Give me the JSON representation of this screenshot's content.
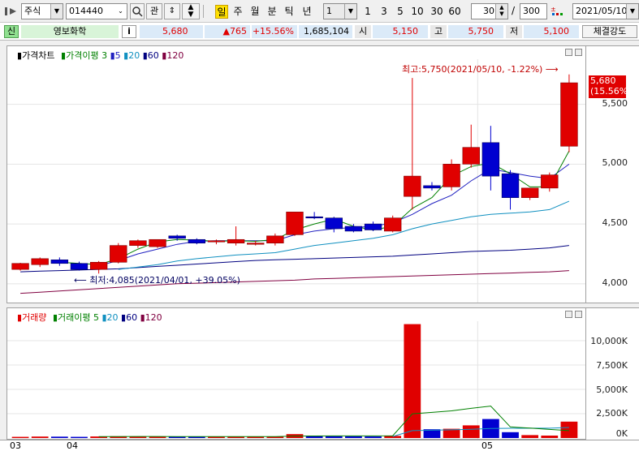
{
  "toolbar": {
    "market_select": "주식",
    "code_input": "014440",
    "search_label": "관",
    "periods": [
      "일",
      "주",
      "월",
      "분",
      "틱",
      "년"
    ],
    "selected_period": "일",
    "interval_value": "1",
    "interval_buttons": [
      "1",
      "3",
      "5",
      "10",
      "30",
      "60"
    ],
    "display_count": "30",
    "total_count": "300",
    "date_value": "2021/05/10"
  },
  "quote": {
    "credit_tag": "신",
    "name": "영보화학",
    "info_label": "i",
    "price": "5,680",
    "change": "▲765",
    "change_pct": "+15.56%",
    "volume": "1,685,104",
    "open_label": "시",
    "open": "5,150",
    "high_label": "고",
    "high": "5,750",
    "low_label": "저",
    "low": "5,100",
    "strength_label": "체결강도"
  },
  "price_panel": {
    "legend_title": "가격차트",
    "ma_title": "가격이평",
    "ma_periods": [
      "3",
      "5",
      "20",
      "60",
      "120"
    ],
    "high_annotation": "최고:5,750(2021/05/10, -1.22%)",
    "low_annotation": "최저:4,085(2021/04/01, +39.05%)",
    "current_price": "5,680",
    "current_pct": "(15.56%)",
    "y_labels": [
      "5,500",
      "5,000",
      "4,500",
      "4,000"
    ]
  },
  "volume_panel": {
    "legend_title": "거래량",
    "ma_title": "거래이평",
    "ma_periods": [
      "5",
      "20",
      "60",
      "120"
    ],
    "y_labels": [
      "10,000K",
      "7,500K",
      "5,000K",
      "2,500K",
      "0K"
    ]
  },
  "x_labels": [
    "03",
    "04",
    "05"
  ],
  "colors": {
    "up": "#e00000",
    "down": "#0000d0",
    "ma3": "#008000",
    "ma5": "#2020c0",
    "ma20": "#1090c0",
    "ma60": "#000080",
    "ma120": "#800040"
  },
  "chart_data": {
    "type": "candlestick",
    "price_range": [
      3870,
      5850
    ],
    "candles": [
      {
        "o": 4120,
        "h": 4175,
        "l": 4110,
        "c": 4170
      },
      {
        "o": 4160,
        "h": 4220,
        "l": 4140,
        "c": 4210
      },
      {
        "o": 4200,
        "h": 4220,
        "l": 4150,
        "c": 4170
      },
      {
        "o": 4170,
        "h": 4185,
        "l": 4110,
        "c": 4120
      },
      {
        "o": 4120,
        "h": 4190,
        "l": 4085,
        "c": 4180
      },
      {
        "o": 4180,
        "h": 4340,
        "l": 4170,
        "c": 4320
      },
      {
        "o": 4320,
        "h": 4370,
        "l": 4300,
        "c": 4360
      },
      {
        "o": 4310,
        "h": 4370,
        "l": 4300,
        "c": 4370
      },
      {
        "o": 4400,
        "h": 4410,
        "l": 4360,
        "c": 4380
      },
      {
        "o": 4370,
        "h": 4380,
        "l": 4330,
        "c": 4340
      },
      {
        "o": 4350,
        "h": 4370,
        "l": 4330,
        "c": 4360
      },
      {
        "o": 4340,
        "h": 4480,
        "l": 4320,
        "c": 4370
      },
      {
        "o": 4330,
        "h": 4360,
        "l": 4320,
        "c": 4340
      },
      {
        "o": 4340,
        "h": 4420,
        "l": 4320,
        "c": 4400
      },
      {
        "o": 4410,
        "h": 4600,
        "l": 4400,
        "c": 4600
      },
      {
        "o": 4560,
        "h": 4600,
        "l": 4540,
        "c": 4550
      },
      {
        "o": 4550,
        "h": 4560,
        "l": 4430,
        "c": 4460
      },
      {
        "o": 4480,
        "h": 4500,
        "l": 4430,
        "c": 4440
      },
      {
        "o": 4500,
        "h": 4520,
        "l": 4440,
        "c": 4450
      },
      {
        "o": 4440,
        "h": 4570,
        "l": 4430,
        "c": 4550
      },
      {
        "o": 4730,
        "h": 5720,
        "l": 4620,
        "c": 4900
      },
      {
        "o": 4820,
        "h": 4850,
        "l": 4780,
        "c": 4800
      },
      {
        "o": 4810,
        "h": 5040,
        "l": 4780,
        "c": 5000
      },
      {
        "o": 5000,
        "h": 5330,
        "l": 4970,
        "c": 5140
      },
      {
        "o": 5180,
        "h": 5320,
        "l": 4780,
        "c": 4900
      },
      {
        "o": 4920,
        "h": 4950,
        "l": 4620,
        "c": 4720
      },
      {
        "o": 4720,
        "h": 4800,
        "l": 4700,
        "c": 4800
      },
      {
        "o": 4800,
        "h": 4930,
        "l": 4770,
        "c": 4910
      },
      {
        "o": 5150,
        "h": 5750,
        "l": 5100,
        "c": 5680
      }
    ],
    "volume_range": [
      0,
      12000
    ],
    "volumes": [
      120,
      150,
      140,
      120,
      160,
      180,
      170,
      130,
      140,
      140,
      140,
      160,
      140,
      130,
      400,
      200,
      180,
      170,
      160,
      220,
      11700,
      900,
      950,
      1300,
      1950,
      600,
      300,
      250,
      1685
    ],
    "volume_up": [
      true,
      true,
      false,
      false,
      true,
      true,
      true,
      true,
      false,
      false,
      true,
      true,
      true,
      true,
      true,
      false,
      false,
      false,
      false,
      true,
      true,
      false,
      true,
      true,
      false,
      false,
      true,
      true,
      true
    ],
    "ma3": [
      null,
      null,
      4180,
      4170,
      4160,
      4210,
      4290,
      4350,
      4370,
      4365,
      4355,
      4360,
      4355,
      4370,
      4450,
      4500,
      4540,
      4480,
      4450,
      4480,
      4630,
      4720,
      4900,
      4980,
      5010,
      4920,
      4810,
      4810,
      5110
    ],
    "ma5": [
      null,
      null,
      null,
      null,
      4150,
      4195,
      4250,
      4290,
      4330,
      4355,
      4360,
      4360,
      4360,
      4360,
      4410,
      4440,
      4460,
      4470,
      4480,
      4510,
      4580,
      4670,
      4740,
      4860,
      4960,
      4930,
      4900,
      4880,
      5000
    ],
    "ma20": [
      null,
      null,
      null,
      null,
      null,
      4120,
      4140,
      4160,
      4190,
      4210,
      4225,
      4240,
      4250,
      4260,
      4290,
      4320,
      4340,
      4360,
      4380,
      4410,
      4460,
      4500,
      4530,
      4560,
      4580,
      4590,
      4600,
      4620,
      4690
    ],
    "ma60": [
      4100,
      4105,
      4110,
      4115,
      4120,
      4125,
      4135,
      4145,
      4155,
      4165,
      4175,
      4185,
      4195,
      4200,
      4205,
      4210,
      4215,
      4220,
      4225,
      4230,
      4240,
      4250,
      4260,
      4270,
      4275,
      4280,
      4290,
      4300,
      4320
    ],
    "ma120": [
      3920,
      3930,
      3940,
      3950,
      3960,
      3970,
      3980,
      3990,
      4000,
      4005,
      4010,
      4015,
      4020,
      4025,
      4030,
      4040,
      4045,
      4050,
      4055,
      4060,
      4065,
      4070,
      4075,
      4080,
      4085,
      4090,
      4095,
      4100,
      4110
    ],
    "vol_ma5": [
      null,
      null,
      null,
      null,
      140,
      150,
      160,
      160,
      150,
      150,
      150,
      150,
      150,
      140,
      200,
      210,
      220,
      220,
      220,
      230,
      2480,
      2630,
      2790,
      3050,
      3280,
      1140,
      1020,
      880,
      760
    ],
    "vol_ma20": [
      null,
      null,
      null,
      null,
      null,
      null,
      null,
      null,
      null,
      null,
      null,
      null,
      null,
      null,
      null,
      null,
      null,
      null,
      null,
      160,
      760,
      800,
      840,
      900,
      980,
      1000,
      1010,
      1010,
      1080
    ],
    "x_label_positions": [
      0,
      5,
      24
    ]
  }
}
